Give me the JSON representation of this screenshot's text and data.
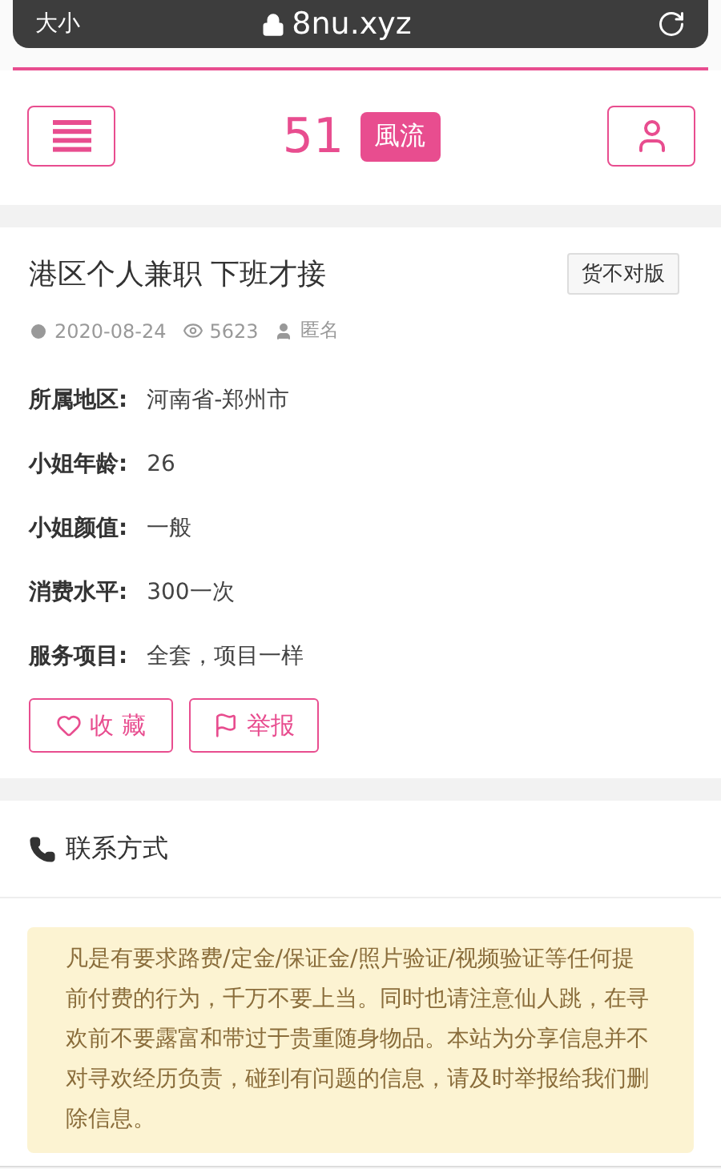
{
  "browser_bar": {
    "text_size_button": "大小",
    "url": "8nu.xyz"
  },
  "header": {
    "logo_number": "51",
    "logo_badge": "風流"
  },
  "listing": {
    "title": "港区个人兼职 下班才接",
    "flag_button": "货不对版",
    "date": "2020-08-24",
    "views": "5623",
    "author": "匿名",
    "fields": [
      {
        "label": "所属地区:",
        "value": "河南省-郑州市"
      },
      {
        "label": "小姐年龄:",
        "value": "26"
      },
      {
        "label": "小姐颜值:",
        "value": "一般"
      },
      {
        "label": "消费水平:",
        "value": "300一次"
      },
      {
        "label": "服务项目:",
        "value": "全套，项目一样"
      }
    ],
    "actions": [
      {
        "kind": "favorite",
        "label": "收 藏"
      },
      {
        "kind": "report",
        "label": "举报"
      }
    ]
  },
  "contact": {
    "title": "联系方式",
    "notice": "凡是有要求路费/定金/保证金/照片验证/视频验证等任何提前付费的行为，千万不要上当。同时也请注意仙人跳，在寻欢前不要露富和带过于贵重随身物品。本站为分享信息并不对寻欢经历负责，碰到有问题的信息，请及时举报给我们删除信息。"
  }
}
